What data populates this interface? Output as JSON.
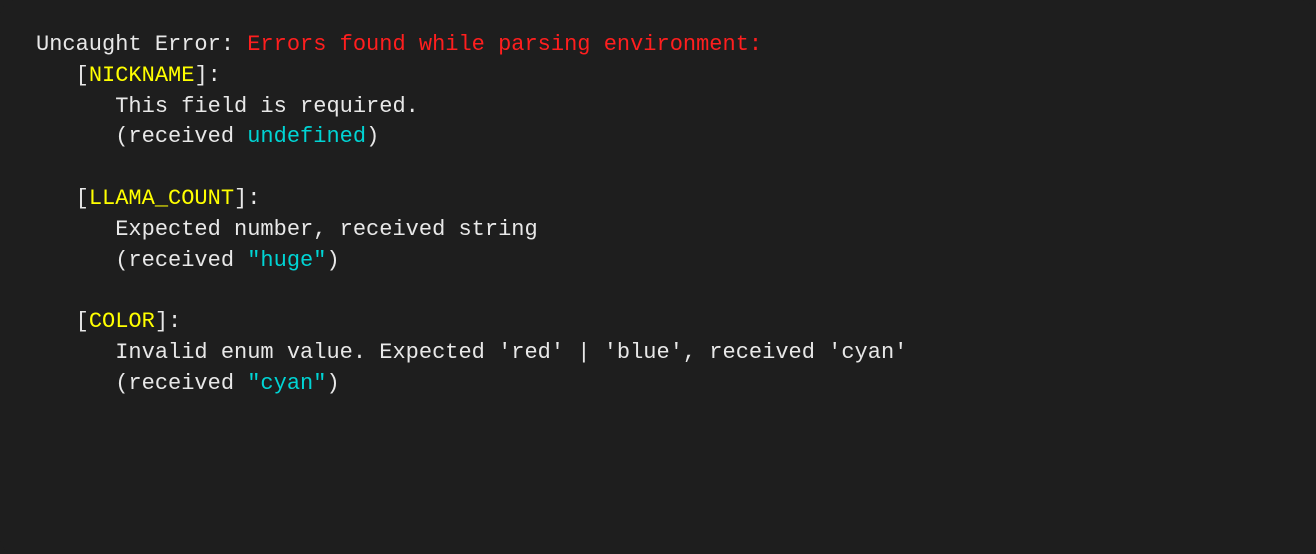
{
  "error": {
    "prefix": "Uncaught Error: ",
    "headline": "Errors found while parsing environment:",
    "fields": [
      {
        "bracket_open": "   [",
        "name": "NICKNAME",
        "bracket_close": "]:",
        "message": "      This field is required.",
        "received_open": "      (received ",
        "received_value": "undefined",
        "received_close": ")"
      },
      {
        "bracket_open": "   [",
        "name": "LLAMA_COUNT",
        "bracket_close": "]:",
        "message": "      Expected number, received string",
        "received_open": "      (received ",
        "received_value": "\"huge\"",
        "received_close": ")"
      },
      {
        "bracket_open": "   [",
        "name": "COLOR",
        "bracket_close": "]:",
        "message": "      Invalid enum value. Expected 'red' | 'blue', received 'cyan'",
        "received_open": "      (received ",
        "received_value": "\"cyan\"",
        "received_close": ")"
      }
    ]
  }
}
